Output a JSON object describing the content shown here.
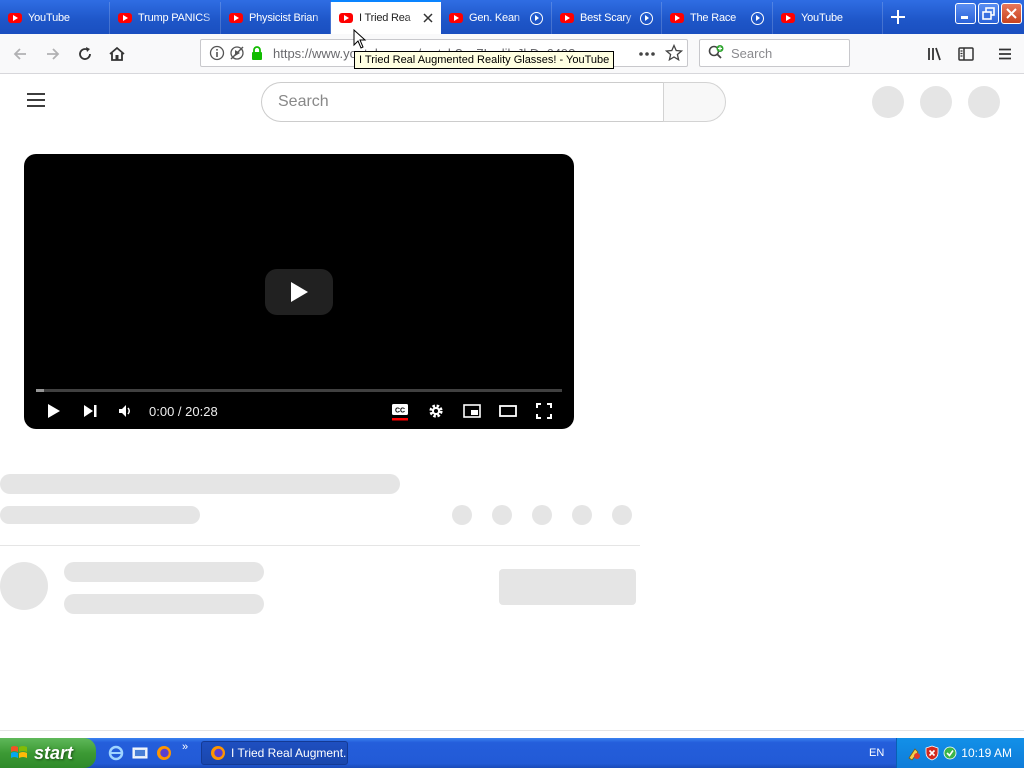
{
  "browser": {
    "tabs": [
      {
        "label": "YouTube",
        "active": false,
        "media": false
      },
      {
        "label": "Trump PANICS",
        "active": false,
        "media": false
      },
      {
        "label": "Physicist Brian",
        "active": false,
        "media": false
      },
      {
        "label": "I Tried Rea",
        "active": true,
        "media": false
      },
      {
        "label": "Gen. Kean",
        "active": false,
        "media": true
      },
      {
        "label": "Best Scary",
        "active": false,
        "media": true
      },
      {
        "label": "The Race",
        "active": false,
        "media": true
      },
      {
        "label": "YouTube",
        "active": false,
        "media": false
      }
    ],
    "url": "https://www.youtube.com/watch?v=7LcrlilzJkD_6492",
    "search_placeholder": "Search",
    "tooltip": "I Tried Real Augmented Reality Glasses! - YouTube"
  },
  "youtube": {
    "search_placeholder": "Search",
    "player": {
      "time_display": "0:00 / 20:28",
      "loaded_fraction": 0.015
    }
  },
  "taskbar": {
    "start_label": "start",
    "task_item": "I Tried Real Augment...",
    "language": "EN",
    "clock": "10:19 AM"
  },
  "colors": {
    "xp_blue": "#245edb",
    "youtube_red": "#ff0000",
    "skeleton": "#e5e5e5"
  }
}
